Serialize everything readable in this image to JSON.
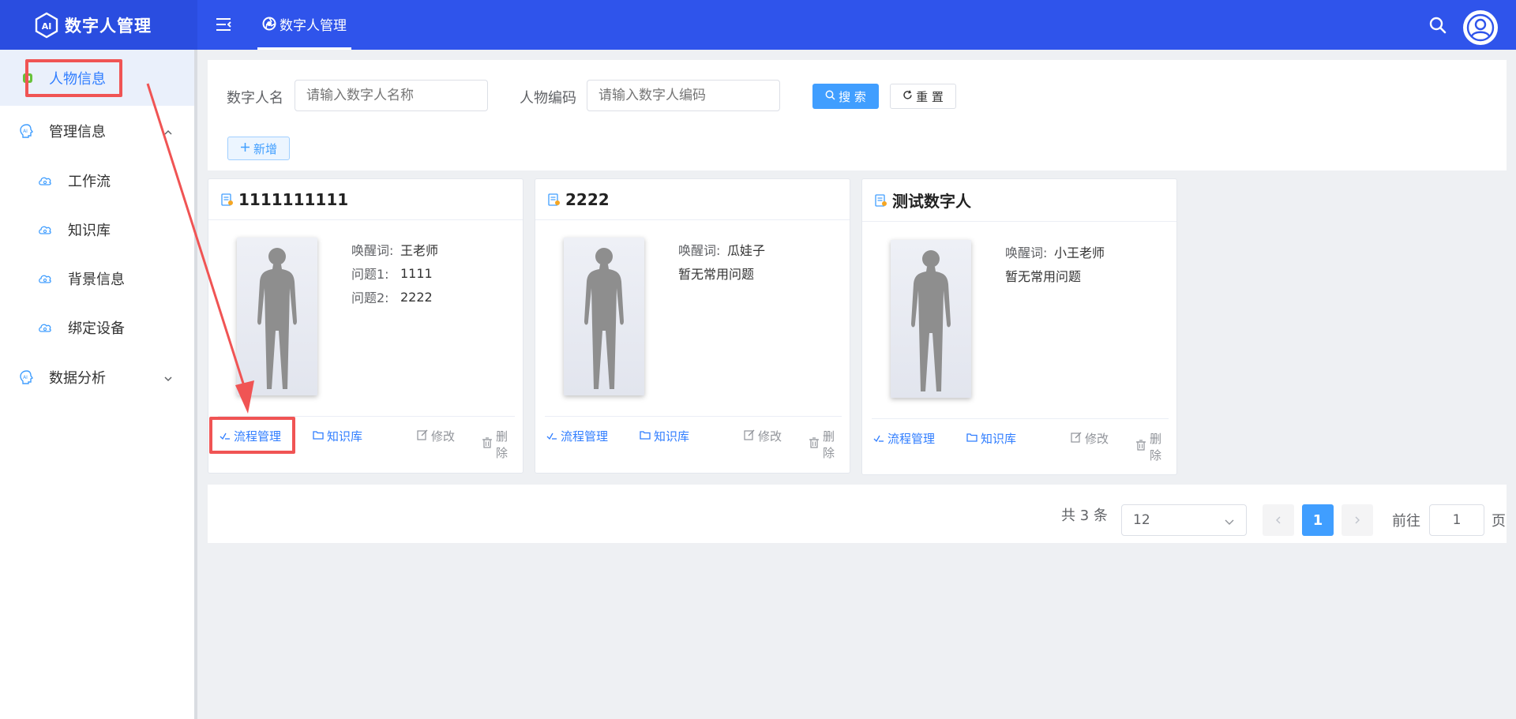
{
  "app": {
    "title": "数字人管理"
  },
  "header": {
    "active_tab": "数字人管理"
  },
  "sidebar": {
    "items": [
      {
        "label": "人物信息",
        "icon": "app-icon"
      },
      {
        "label": "管理信息",
        "icon": "ai-head-icon",
        "expanded": true
      },
      {
        "label": "工作流",
        "icon": "cloud-icon"
      },
      {
        "label": "知识库",
        "icon": "cloud-icon"
      },
      {
        "label": "背景信息",
        "icon": "cloud-icon"
      },
      {
        "label": "绑定设备",
        "icon": "cloud-icon"
      },
      {
        "label": "数据分析",
        "icon": "ai-head-icon",
        "expanded": false
      }
    ]
  },
  "search": {
    "name_label": "数字人名",
    "name_placeholder": "请输入数字人名称",
    "code_label": "人物编码",
    "code_placeholder": "请输入数字人编码",
    "search_button": "搜 索",
    "reset_button": "重 置",
    "add_button": "新增"
  },
  "cards": [
    {
      "title": "1111111111",
      "wake_label": "唤醒词:",
      "wake_value": "王老师",
      "q1_label": "问题1:",
      "q1_value": "1111",
      "q2_label": "问题2:",
      "q2_value": "2222",
      "actions": {
        "flow": "流程管理",
        "kb": "知识库",
        "edit": "修改",
        "delete": "删除"
      }
    },
    {
      "title": "2222",
      "wake_label": "唤醒词:",
      "wake_value": "瓜娃子",
      "no_questions": "暂无常用问题",
      "actions": {
        "flow": "流程管理",
        "kb": "知识库",
        "edit": "修改",
        "delete": "删除"
      }
    },
    {
      "title": "测试数字人",
      "wake_label": "唤醒词:",
      "wake_value": "小王老师",
      "no_questions": "暂无常用问题",
      "actions": {
        "flow": "流程管理",
        "kb": "知识库",
        "edit": "修改",
        "delete": "删除"
      }
    }
  ],
  "pagination": {
    "total": "共 3 条",
    "page_size": "12",
    "current_page": "1",
    "goto_label": "前往",
    "goto_value": "1",
    "goto_suffix": "页"
  },
  "colors": {
    "brand_blue": "#2f54eb",
    "primary": "#409eff",
    "annotation_red": "#f05454"
  }
}
